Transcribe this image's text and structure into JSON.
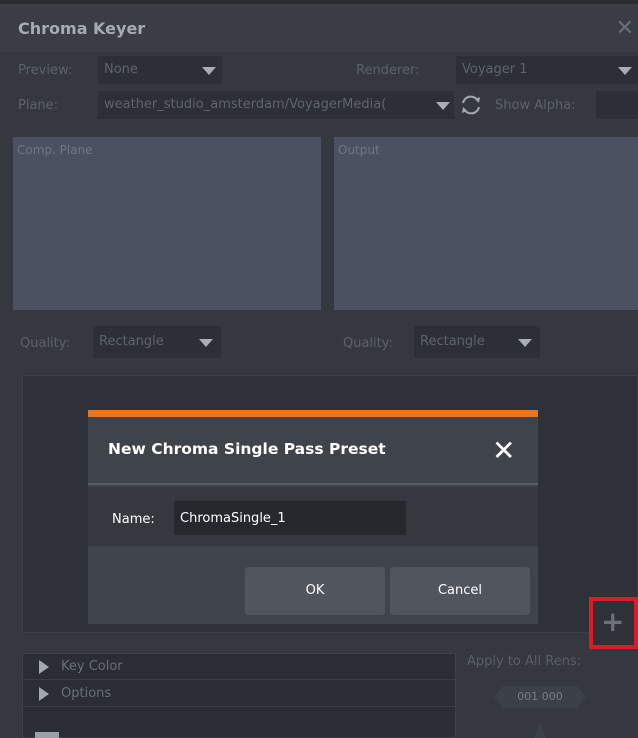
{
  "window": {
    "title": "Chroma Keyer"
  },
  "preview": {
    "label": "Preview:",
    "value": "None"
  },
  "renderer": {
    "label": "Renderer:",
    "value": "Voyager 1"
  },
  "plane": {
    "label": "Plane:",
    "value": "weather_studio_amsterdam/VoyagerMedia("
  },
  "show_alpha": {
    "label": "Show Alpha:"
  },
  "panels": {
    "comp_plane": "Comp. Plane",
    "output": "Output"
  },
  "quality_left": {
    "label": "Quality:",
    "value": "Rectangle"
  },
  "quality_right": {
    "label": "Quality:",
    "value": "Rectangle"
  },
  "add_button": {
    "symbol": "+"
  },
  "tree": {
    "items": [
      "Key Color",
      "Options"
    ]
  },
  "apply_all": {
    "label": "Apply to All Rens:",
    "counter_left": "001",
    "counter_right": "000"
  },
  "dialog": {
    "title": "New Chroma Single Pass Preset",
    "close_symbol": "✕",
    "name_label": "Name:",
    "name_value": "ChromaSingle_1",
    "ok_label": "OK",
    "cancel_label": "Cancel"
  },
  "colors": {
    "accent": "#e8761f",
    "highlight": "#e01a22"
  }
}
